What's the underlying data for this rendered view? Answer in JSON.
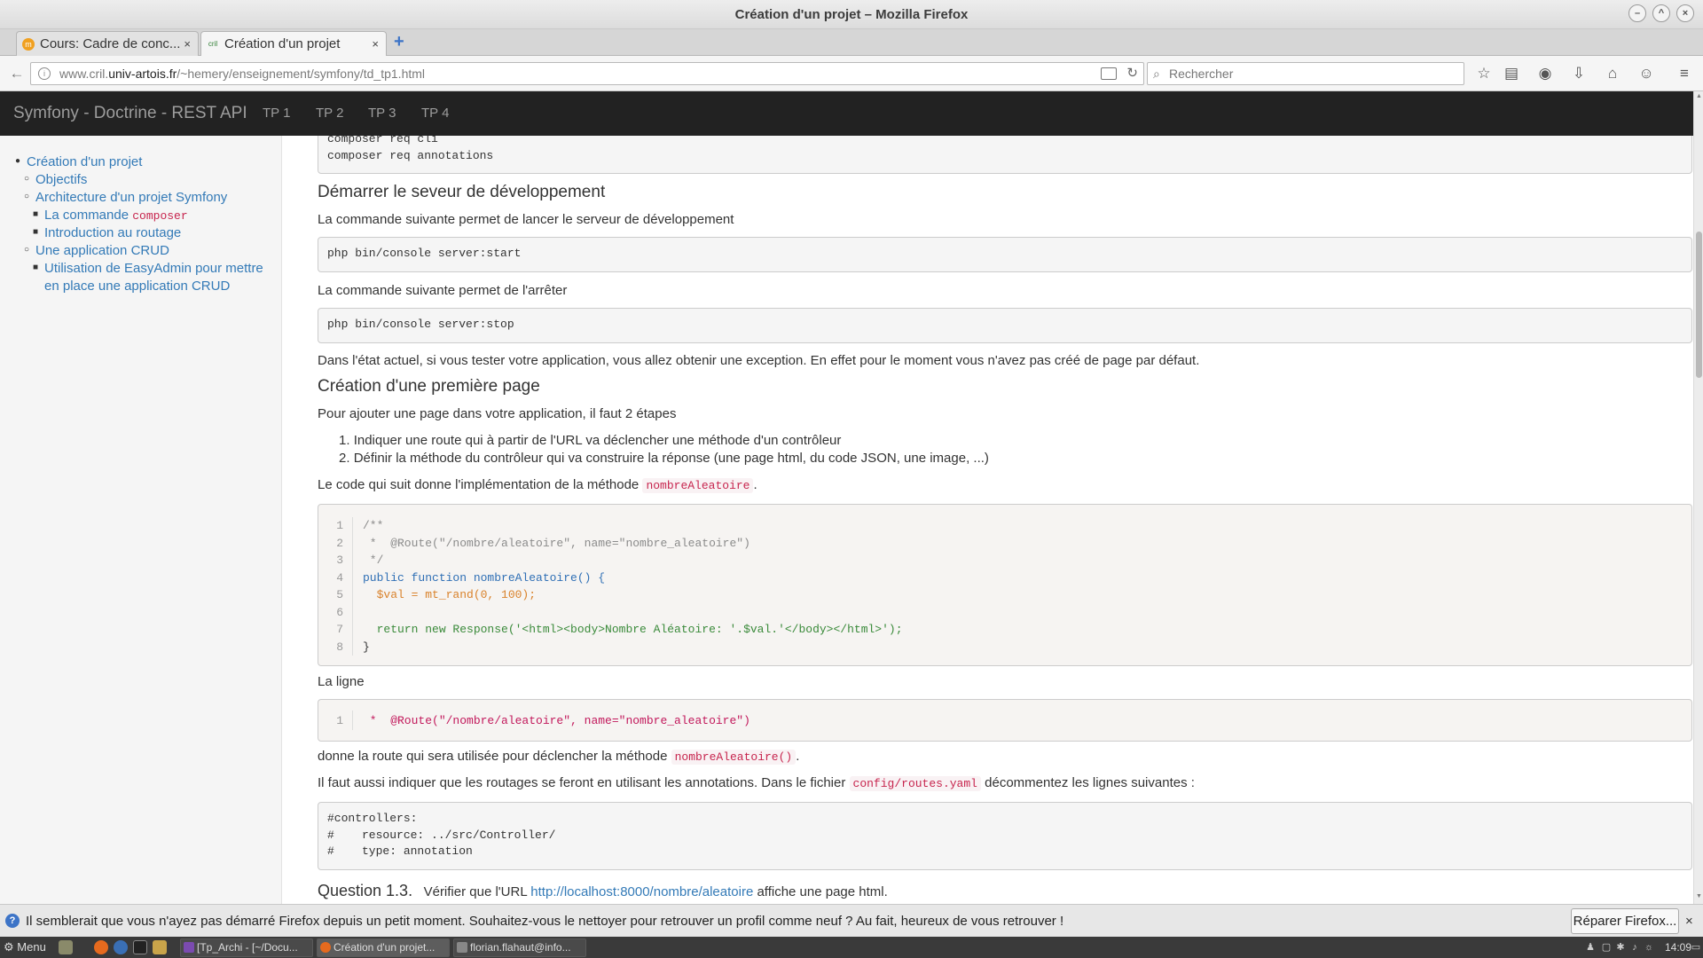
{
  "window": {
    "title": "Création d'un projet – Mozilla Firefox"
  },
  "tabs": [
    {
      "label": "Cours: Cadre de conc...",
      "active": false
    },
    {
      "label": "Création d'un projet",
      "active": true
    }
  ],
  "urlbar": {
    "prefix": "www.cril.",
    "domain": "univ-artois.fr",
    "path": "/~hemery/enseignement/symfony/td_tp1.html"
  },
  "searchbar": {
    "placeholder": "Rechercher"
  },
  "site_nav": {
    "brand": "Symfony - Doctrine - REST API",
    "items": [
      "TP 1",
      "TP 2",
      "TP 3",
      "TP 4"
    ]
  },
  "toc": {
    "creation": "Création d'un projet",
    "objectifs": "Objectifs",
    "architecture": "Architecture d'un projet Symfony",
    "commande_prefix": "La commande ",
    "commande_code": "composer",
    "routage": "Introduction au routage",
    "crud": "Une application CRUD",
    "easyadmin_1": "Utilisation de EasyAdmin pour mettre",
    "easyadmin_2": "en place une application CRUD"
  },
  "content": {
    "pre_top_line1": "composer req cli",
    "pre_top_line2": "composer req annotations",
    "h_demarrer": "Démarrer le seveur de développement",
    "p_lancer": "La commande suivante permet de lancer le serveur de développement",
    "pre_start": "php bin/console server:start",
    "p_arreter": "La commande suivante permet de l'arrêter",
    "pre_stop": "php bin/console server:stop",
    "p_exception": "Dans l'état actuel, si vous tester votre application, vous allez obtenir une exception. En effet pour le moment vous n'avez pas créé de page par défaut.",
    "h_premiere": "Création d'une première page",
    "p_etapes": "Pour ajouter une page dans votre application, il faut 2 étapes",
    "step1": "Indiquer une route qui à partir de l'URL va déclencher une méthode d'un contrôleur",
    "step2": "Définir la méthode du contrôleur qui va construire la réponse (une page html, du code JSON, une image, ...)",
    "p_code_prefix": "Le code qui suit donne l'implémentation de la méthode ",
    "p_code_method": "nombreAleatoire",
    "p_code_suffix": ".",
    "code_lines": [
      "/**",
      " *  @Route(\"/nombre/aleatoire\", name=\"nombre_aleatoire\")",
      " */",
      "public function nombreAleatoire() {",
      "  $val = mt_rand(0, 100);",
      "",
      "  return new Response('<html><body>Nombre Aléatoire: '.$val.'</body></html>');",
      "}"
    ],
    "p_ligne": "La ligne",
    "p_route_prefix": "donne la route qui sera utilisée pour déclencher la méthode ",
    "p_route_method": "nombreAleatoire()",
    "p_route_suffix": ".",
    "p_routes_prefix": "Il faut aussi indiquer que les routages se feront en utilisant les annotations. Dans le fichier ",
    "p_routes_file": "config/routes.yaml",
    "p_routes_suffix": " décommentez les lignes suivantes :",
    "yaml_line1": "#controllers:",
    "yaml_line2": "#    resource: ../src/Controller/",
    "yaml_line3": "#    type: annotation",
    "question_label": "Question 1.3.",
    "question_prefix": "Vérifier que l'URL ",
    "question_link": "http://localhost:8000/nombre/aleatoire",
    "question_suffix": " affiche une page html."
  },
  "notification": {
    "message": "Il semblerait que vous n'ayez pas démarré Firefox depuis un petit moment. Souhaitez-vous le nettoyer pour retrouver un profil comme neuf ? Au fait, heureux de vous retrouver !",
    "button": "Réparer Firefox..."
  },
  "taskbar": {
    "menu": "Menu",
    "tasks": [
      "[Tp_Archi - [~/Docu...",
      "Création d'un projet...",
      "florian.flahaut@info..."
    ],
    "clock": "14:09"
  },
  "colors": {
    "link": "#337ab7",
    "code_inline": "#c7254e",
    "page_navbar": "#222222"
  }
}
